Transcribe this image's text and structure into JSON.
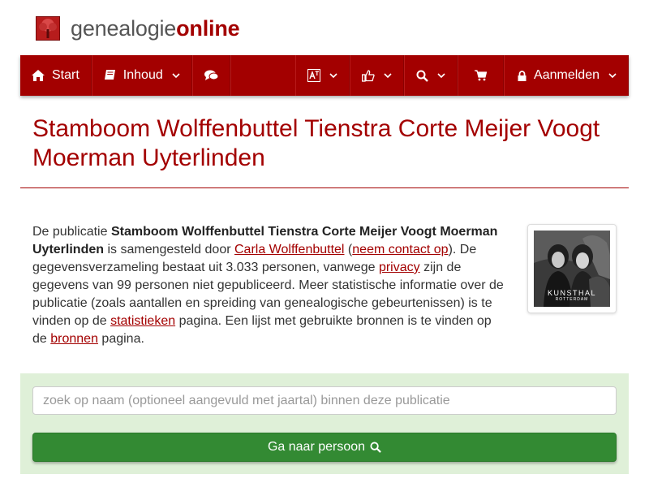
{
  "brand": {
    "name_part1": "genealogie",
    "name_part2": "online"
  },
  "nav": {
    "start_label": "Start",
    "inhoud_label": "Inhoud",
    "login_label": "Aanmelden",
    "icons": [
      "home-icon",
      "book-icon",
      "comments-icon",
      "translate-icon",
      "thumbs-up-icon",
      "search-icon",
      "cart-icon",
      "lock-icon"
    ]
  },
  "page": {
    "title": "Stamboom Wolffenbuttel Tienstra Corte Meijer Voogt Moerman Uyterlinden"
  },
  "description": {
    "t1": "De publicatie ",
    "pub_name": "Stamboom Wolffenbuttel Tienstra Corte Meijer Voogt Moerman Uyterlinden",
    "t2": " is samengesteld door ",
    "author_link": "Carla Wolffenbuttel",
    "t3": " (",
    "contact_link": "neem contact op",
    "t4": "). De gegevensverzameling bestaat uit 3.033 personen, vanwege ",
    "privacy_link": "privacy",
    "t5": " zijn de gegevens van 99 personen niet gepubliceerd. Meer statistische informatie over de publicatie (zoals aantallen en spreiding van genealogische gebeurtenissen) is te vinden op de ",
    "stats_link": "statistieken",
    "t6": " pagina. Een lijst met gebruikte bronnen is te vinden op de ",
    "sources_link": "bronnen",
    "t7": " pagina."
  },
  "photo": {
    "caption_line1": "KUNSTHAL",
    "caption_line2": "ROTTERDAM"
  },
  "search": {
    "placeholder": "zoek op naam (optioneel aangevuld met jaartal) binnen deze publicatie",
    "value": "",
    "button_label": "Ga naar persoon"
  },
  "colors": {
    "brand_red": "#a30000",
    "success_green": "#338a33",
    "panel_green": "#dff0d8"
  }
}
